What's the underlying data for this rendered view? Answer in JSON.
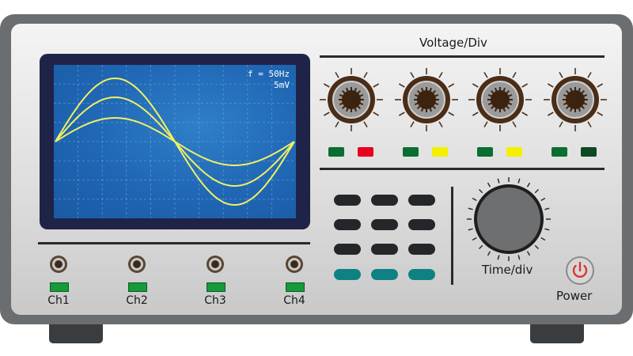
{
  "screen": {
    "frequency_label": "f = 50Hz",
    "scale_label": "5mV",
    "colors": {
      "bezel": "#1f2347",
      "screen": "#1f66b4",
      "grid": "#6fa7dc",
      "trace": "#f2f060"
    }
  },
  "voltage_section": {
    "title": "Voltage/Div",
    "knobs": [
      {
        "name": "voltage-knob-1",
        "leds": [
          "#0a6e32",
          "#e8001c"
        ]
      },
      {
        "name": "voltage-knob-2",
        "leds": [
          "#0a6e32",
          "#f5f000"
        ]
      },
      {
        "name": "voltage-knob-3",
        "leds": [
          "#0a6e32",
          "#f5f000"
        ]
      },
      {
        "name": "voltage-knob-4",
        "leds": [
          "#0a6e32",
          "#0b4a22"
        ]
      }
    ]
  },
  "time_section": {
    "label": "Time/div"
  },
  "power": {
    "label": "Power",
    "icon": "power-icon",
    "color": "#d9382b"
  },
  "channels": [
    {
      "label": "Ch1"
    },
    {
      "label": "Ch2"
    },
    {
      "label": "Ch3"
    },
    {
      "label": "Ch4"
    }
  ]
}
